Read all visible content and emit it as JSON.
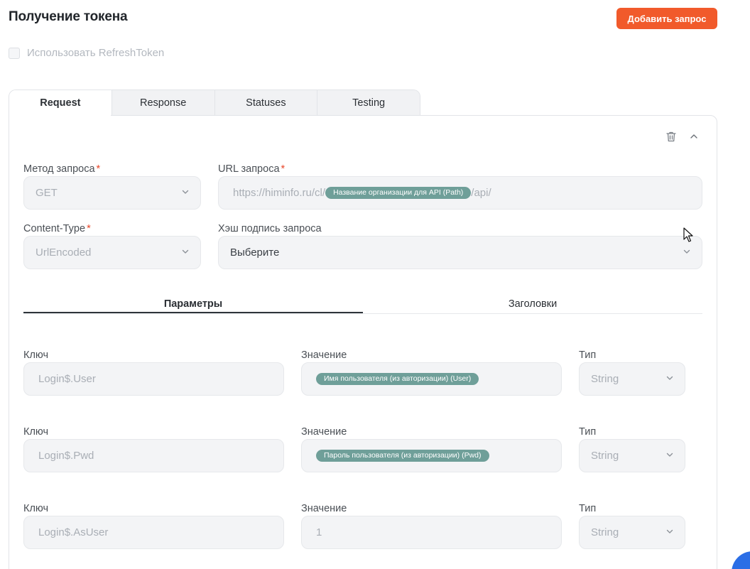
{
  "header": {
    "title": "Получение токена",
    "add_request_label": "Добавить запрос"
  },
  "refresh_token": {
    "label": "Использовать RefreshToken",
    "checked": false
  },
  "tabs": [
    {
      "label": "Request",
      "active": true
    },
    {
      "label": "Response",
      "active": false
    },
    {
      "label": "Statuses",
      "active": false
    },
    {
      "label": "Testing",
      "active": false
    }
  ],
  "toolbar_icons": [
    "trash-icon",
    "chevron-up-icon"
  ],
  "form": {
    "method": {
      "label": "Метод запроса",
      "required": "*",
      "value": "GET"
    },
    "url": {
      "label": "URL запроса",
      "required": "*",
      "prefix": "https://himinfo.ru/cl/",
      "chip": "Название организации для API (Path)",
      "suffix": "/api/"
    },
    "content_type": {
      "label": "Content-Type",
      "required": "*",
      "value": "UrlEncoded"
    },
    "hash": {
      "label": "Хэш подпись запроса",
      "value": "Выберите"
    }
  },
  "subtabs": [
    {
      "label": "Параметры",
      "active": true
    },
    {
      "label": "Заголовки",
      "active": false
    }
  ],
  "params": {
    "key_label": "Ключ",
    "value_label": "Значение",
    "type_label": "Тип",
    "rows": [
      {
        "key": "Login$.User",
        "value_chip": "Имя пользователя (из авторизации) (User)",
        "value_text": "",
        "type": "String"
      },
      {
        "key": "Login$.Pwd",
        "value_chip": "Пароль пользователя (из авторизации) (Pwd)",
        "value_text": "",
        "type": "String"
      },
      {
        "key": "Login$.AsUser",
        "value_chip": "",
        "value_text": "1",
        "type": "String"
      }
    ]
  },
  "colors": {
    "accent": "#f15a2b",
    "chip": "#6f9f99",
    "required": "#e8472a",
    "fab": "#2b6ee6"
  }
}
